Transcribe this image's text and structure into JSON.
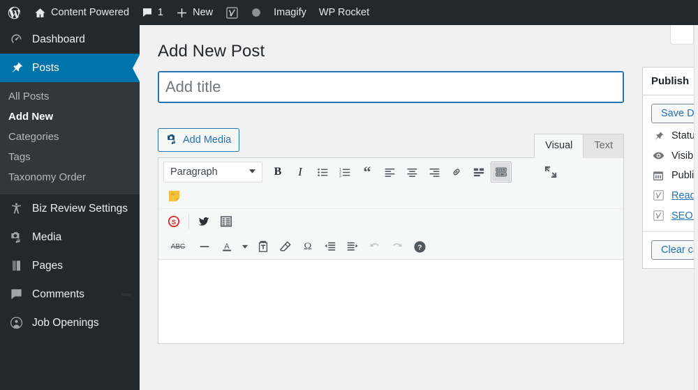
{
  "adminbar": {
    "items": [
      {
        "icon": "wordpress-logo-icon",
        "label": ""
      },
      {
        "icon": "home-icon",
        "label": "Content Powered"
      },
      {
        "icon": "comment-bubble-icon",
        "label": "1"
      },
      {
        "icon": "plus-icon",
        "label": "New"
      },
      {
        "icon": "yoast-seo-icon",
        "label": ""
      },
      {
        "icon": "circle-icon",
        "label": ""
      },
      {
        "icon": "",
        "label": "Imagify"
      },
      {
        "icon": "",
        "label": "WP Rocket"
      }
    ]
  },
  "sidebar": {
    "items": [
      {
        "icon": "dashboard-gauge-icon",
        "label": "Dashboard",
        "current": false
      },
      {
        "icon": "pin-icon",
        "label": "Posts",
        "current": true
      },
      {
        "icon": "accessibility-person-icon",
        "label": "Biz Review Settings",
        "current": false
      },
      {
        "icon": "media-camera-music-icon",
        "label": "Media",
        "current": false
      },
      {
        "icon": "pages-icon",
        "label": "Pages",
        "current": false
      },
      {
        "icon": "comment-bubble-icon",
        "label": "Comments",
        "current": false,
        "badge": ""
      },
      {
        "icon": "user-avatar-icon",
        "label": "Job Openings",
        "current": false
      }
    ],
    "submenu": [
      {
        "label": "All Posts",
        "current": false
      },
      {
        "label": "Add New",
        "current": true
      },
      {
        "label": "Categories",
        "current": false
      },
      {
        "label": "Tags",
        "current": false
      },
      {
        "label": "Taxonomy Order",
        "current": false
      }
    ]
  },
  "main": {
    "page_title": "Add New Post",
    "title_field": {
      "value": "",
      "placeholder": "Add title"
    },
    "add_media_label": "Add Media",
    "tabs": [
      {
        "label": "Visual",
        "active": true
      },
      {
        "label": "Text",
        "active": false
      }
    ],
    "toolbar": {
      "format_select": "Paragraph",
      "row1": [
        {
          "name": "bold-icon",
          "glyph": "B"
        },
        {
          "name": "italic-icon",
          "glyph": "I"
        },
        {
          "name": "bulleted-list-icon",
          "glyph": ""
        },
        {
          "name": "numbered-list-icon",
          "glyph": ""
        },
        {
          "name": "blockquote-icon",
          "glyph": "“"
        },
        {
          "name": "align-left-icon",
          "glyph": ""
        },
        {
          "name": "align-center-icon",
          "glyph": ""
        },
        {
          "name": "align-right-icon",
          "glyph": ""
        },
        {
          "name": "insert-link-icon",
          "glyph": ""
        },
        {
          "name": "read-more-icon",
          "glyph": ""
        },
        {
          "name": "toolbar-toggle-icon",
          "glyph": ""
        },
        {
          "name": "fullscreen-icon",
          "glyph": ""
        }
      ],
      "row2": [
        {
          "name": "sticky-note-icon",
          "glyph": ""
        }
      ],
      "row3": [
        {
          "name": "shareaholic-icon",
          "glyph": "S"
        },
        {
          "name": "twitter-bird-icon",
          "glyph": ""
        },
        {
          "name": "table-icon",
          "glyph": ""
        }
      ],
      "row4": [
        {
          "name": "strikethrough-icon",
          "glyph": "ABC"
        },
        {
          "name": "horizontal-rule-icon",
          "glyph": ""
        },
        {
          "name": "text-color-icon",
          "glyph": "A"
        },
        {
          "name": "text-color-dropdown-icon",
          "glyph": ""
        },
        {
          "name": "paste-as-text-icon",
          "glyph": ""
        },
        {
          "name": "clear-formatting-icon",
          "glyph": ""
        },
        {
          "name": "special-character-icon",
          "glyph": "Ω"
        },
        {
          "name": "outdent-icon",
          "glyph": ""
        },
        {
          "name": "indent-icon",
          "glyph": ""
        },
        {
          "name": "undo-icon",
          "glyph": ""
        },
        {
          "name": "redo-icon",
          "glyph": ""
        },
        {
          "name": "keyboard-shortcuts-icon",
          "glyph": "?"
        }
      ]
    }
  },
  "publish": {
    "heading": "Publish",
    "save_draft_label": "Save Draft",
    "rows": [
      {
        "icon": "pin-icon",
        "label": "Status:",
        "link": false
      },
      {
        "icon": "eye-icon",
        "label": "Visibility:",
        "link": false
      },
      {
        "icon": "calendar-icon",
        "label": "Publish",
        "link": false
      },
      {
        "icon": "yoast-seo-icon",
        "label": "Readability:",
        "link": true
      },
      {
        "icon": "yoast-seo-icon",
        "label": "SEO:",
        "link": true
      }
    ],
    "clear_cache_label": "Clear cache"
  },
  "colors": {
    "admin_bar": "#23282d",
    "sidebar": "#23282d",
    "submenu": "#32373c",
    "accent_blue": "#0073aa",
    "link_blue": "#2271b1",
    "page_bg": "#f1f1f1",
    "sticky_note": "#f5c63d",
    "shareaholic_red": "#e02020"
  }
}
